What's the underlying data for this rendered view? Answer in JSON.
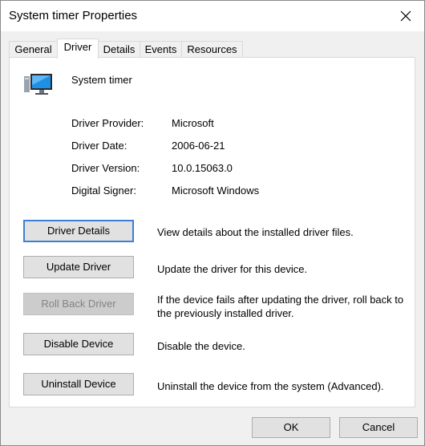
{
  "window": {
    "title": "System timer Properties",
    "close_icon": "close-icon"
  },
  "tabs": [
    {
      "label": "General",
      "active": false
    },
    {
      "label": "Driver",
      "active": true
    },
    {
      "label": "Details",
      "active": false
    },
    {
      "label": "Events",
      "active": false
    },
    {
      "label": "Resources",
      "active": false
    }
  ],
  "device": {
    "icon": "computer-monitor-icon",
    "name": "System timer"
  },
  "properties": [
    {
      "label": "Driver Provider:",
      "value": "Microsoft"
    },
    {
      "label": "Driver Date:",
      "value": "2006-06-21"
    },
    {
      "label": "Driver Version:",
      "value": "10.0.15063.0"
    },
    {
      "label": "Digital Signer:",
      "value": "Microsoft Windows"
    }
  ],
  "actions": [
    {
      "label": "Driver Details",
      "description": "View details about the installed driver files.",
      "state": "focused"
    },
    {
      "label": "Update Driver",
      "description": "Update the driver for this device.",
      "state": "enabled"
    },
    {
      "label": "Roll Back Driver",
      "description": "If the device fails after updating the driver, roll back to the previously installed driver.",
      "state": "disabled"
    },
    {
      "label": "Disable Device",
      "description": "Disable the device.",
      "state": "enabled"
    },
    {
      "label": "Uninstall Device",
      "description": "Uninstall the device from the system (Advanced).",
      "state": "enabled"
    }
  ],
  "footer": {
    "ok_label": "OK",
    "cancel_label": "Cancel"
  },
  "colors": {
    "focus_border": "#3c7fd4",
    "button_face": "#e1e1e1",
    "dialog_background": "#f0f0f0",
    "icon_blue": "#1e90e6"
  }
}
